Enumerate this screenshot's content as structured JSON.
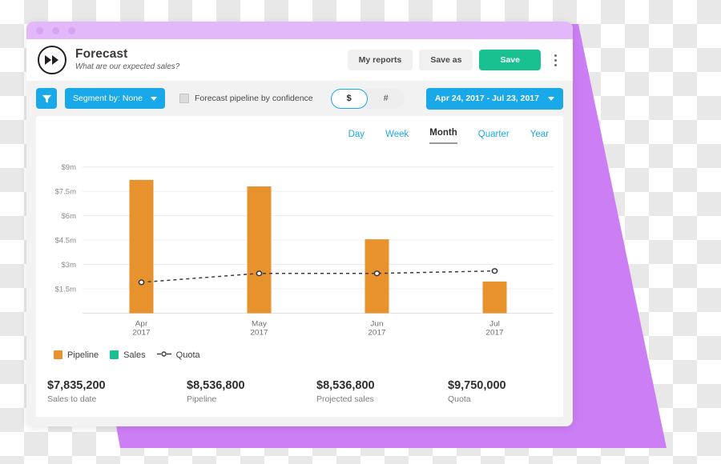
{
  "window": {
    "dots": [
      "dot-1",
      "dot-2",
      "dot-3"
    ]
  },
  "header": {
    "logo_icon": "fast-forward-icon",
    "title": "Forecast",
    "subtitle": "What are our expected sales?",
    "my_reports_label": "My reports",
    "save_as_label": "Save as",
    "save_label": "Save",
    "overflow_icon": "kebab-menu-icon",
    "save_color": "#19c191"
  },
  "toolbar": {
    "filter_icon": "funnel-icon",
    "segment_label": "Segment by: None",
    "segment_caret_icon": "chevron-down-icon",
    "confidence_label": "Forecast pipeline by confidence",
    "confidence_checked": false,
    "currency_options": [
      "$",
      "#"
    ],
    "currency_selected": "$",
    "date_range_label": "Apr 24, 2017 - Jul 23, 2017",
    "date_caret_icon": "chevron-down-icon",
    "accent_color": "#19a8e8"
  },
  "chart_panel": {
    "period_tabs": [
      {
        "label": "Day",
        "active": false
      },
      {
        "label": "Week",
        "active": false
      },
      {
        "label": "Month",
        "active": true
      },
      {
        "label": "Quarter",
        "active": false
      },
      {
        "label": "Year",
        "active": false
      }
    ],
    "legend": [
      {
        "label": "Pipeline",
        "color": "#e8922e",
        "marker": "square"
      },
      {
        "label": "Sales",
        "color": "#19c191",
        "marker": "square"
      },
      {
        "label": "Quota",
        "color": "#3a3a3a",
        "marker": "dashed-line-dot"
      }
    ]
  },
  "chart_data": {
    "type": "bar",
    "title": "",
    "xlabel": "",
    "ylabel": "",
    "categories": [
      "Apr\n2017",
      "May\n2017",
      "Jun\n2017",
      "Jul\n2017"
    ],
    "category_lines": [
      [
        "Apr",
        "2017"
      ],
      [
        "May",
        "2017"
      ],
      [
        "Jun",
        "2017"
      ],
      [
        "Jul",
        "2017"
      ]
    ],
    "ytick_labels": [
      "$9m",
      "$7.5m",
      "$6m",
      "$4.5m",
      "$3m",
      "$1.5m"
    ],
    "ytick_values": [
      9000000,
      7500000,
      6000000,
      4500000,
      3000000,
      1500000
    ],
    "ylim": [
      0,
      9750000
    ],
    "grid": true,
    "legend_position": "bottom-left",
    "series": [
      {
        "name": "Pipeline",
        "type": "bar",
        "color": "#e8922e",
        "values": [
          8200000,
          7800000,
          4550000,
          1950000
        ]
      },
      {
        "name": "Sales",
        "type": "bar",
        "color": "#19c191",
        "values": [
          0,
          0,
          0,
          0
        ]
      },
      {
        "name": "Quota",
        "type": "line",
        "style": "dashed",
        "color": "#3a3a3a",
        "values": [
          1900000,
          2450000,
          2450000,
          2600000
        ]
      }
    ]
  },
  "stats": [
    {
      "value": "$7,835,200",
      "label": "Sales to date"
    },
    {
      "value": "$8,536,800",
      "label": "Pipeline"
    },
    {
      "value": "$8,536,800",
      "label": "Projected sales"
    },
    {
      "value": "$9,750,000",
      "label": "Quota"
    }
  ],
  "decoration": {
    "wedge_color": "#cc7ef5",
    "titlebar_color": "#e3b8fb"
  }
}
